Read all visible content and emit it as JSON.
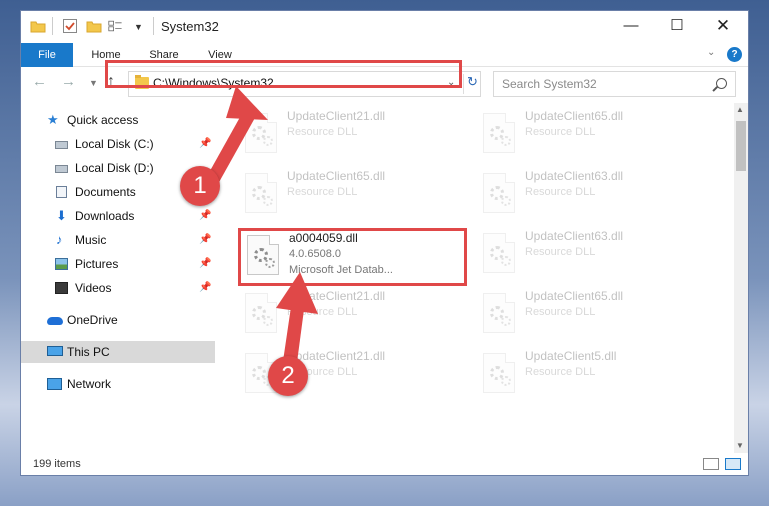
{
  "window": {
    "title": "System32",
    "controls": {
      "minimize": "—",
      "maximize": "☐",
      "close": "✕"
    }
  },
  "ribbon": {
    "tabs": [
      "File",
      "Home",
      "Share",
      "View"
    ],
    "help": "?"
  },
  "nav": {
    "address": "C:\\Windows\\System32",
    "search_placeholder": "Search System32"
  },
  "sidebar": {
    "items": [
      {
        "label": "Quick access",
        "icon": "star-icon",
        "pinned": false
      },
      {
        "label": "Local Disk (C:)",
        "icon": "drive-icon",
        "pinned": true
      },
      {
        "label": "Local Disk (D:)",
        "icon": "drive-icon",
        "pinned": false
      },
      {
        "label": "Documents",
        "icon": "documents-icon",
        "pinned": true
      },
      {
        "label": "Downloads",
        "icon": "downloads-icon",
        "pinned": true
      },
      {
        "label": "Music",
        "icon": "music-icon",
        "pinned": true
      },
      {
        "label": "Pictures",
        "icon": "pictures-icon",
        "pinned": true
      },
      {
        "label": "Videos",
        "icon": "videos-icon",
        "pinned": true
      },
      {
        "label": "OneDrive",
        "icon": "cloud-icon",
        "pinned": false
      },
      {
        "label": "This PC",
        "icon": "pc-icon",
        "pinned": false,
        "selected": true
      },
      {
        "label": "Network",
        "icon": "network-icon",
        "pinned": false
      }
    ]
  },
  "files": [
    {
      "name": "UpdateClient21.dll",
      "type": "Resource DLL",
      "faded": true
    },
    {
      "name": "UpdateClient65.dll",
      "type": "Resource DLL",
      "faded": true
    },
    {
      "name": "UpdateClient65.dll",
      "type": "Resource DLL",
      "faded": true
    },
    {
      "name": "UpdateClient63.dll",
      "type": "Resource DLL",
      "faded": true
    },
    {
      "name": "a0004059.dll",
      "version": "4.0.6508.0",
      "type": "Microsoft Jet Datab...",
      "faded": false
    },
    {
      "name": "UpdateClient63.dll",
      "type": "Resource DLL",
      "faded": true
    },
    {
      "name": "UpdateClient21.dll",
      "type": "Resource DLL",
      "faded": true
    },
    {
      "name": "UpdateClient65.dll",
      "type": "Resource DLL",
      "faded": true
    },
    {
      "name": "UpdateClient21.dll",
      "type": "Resource DLL",
      "faded": true
    },
    {
      "name": "UpdateClient5.dll",
      "type": "Resource DLL",
      "faded": true
    }
  ],
  "status": {
    "count": "199 items"
  },
  "callouts": [
    "1",
    "2"
  ],
  "colors": {
    "accent": "#1979ca",
    "highlight": "#e04848"
  }
}
